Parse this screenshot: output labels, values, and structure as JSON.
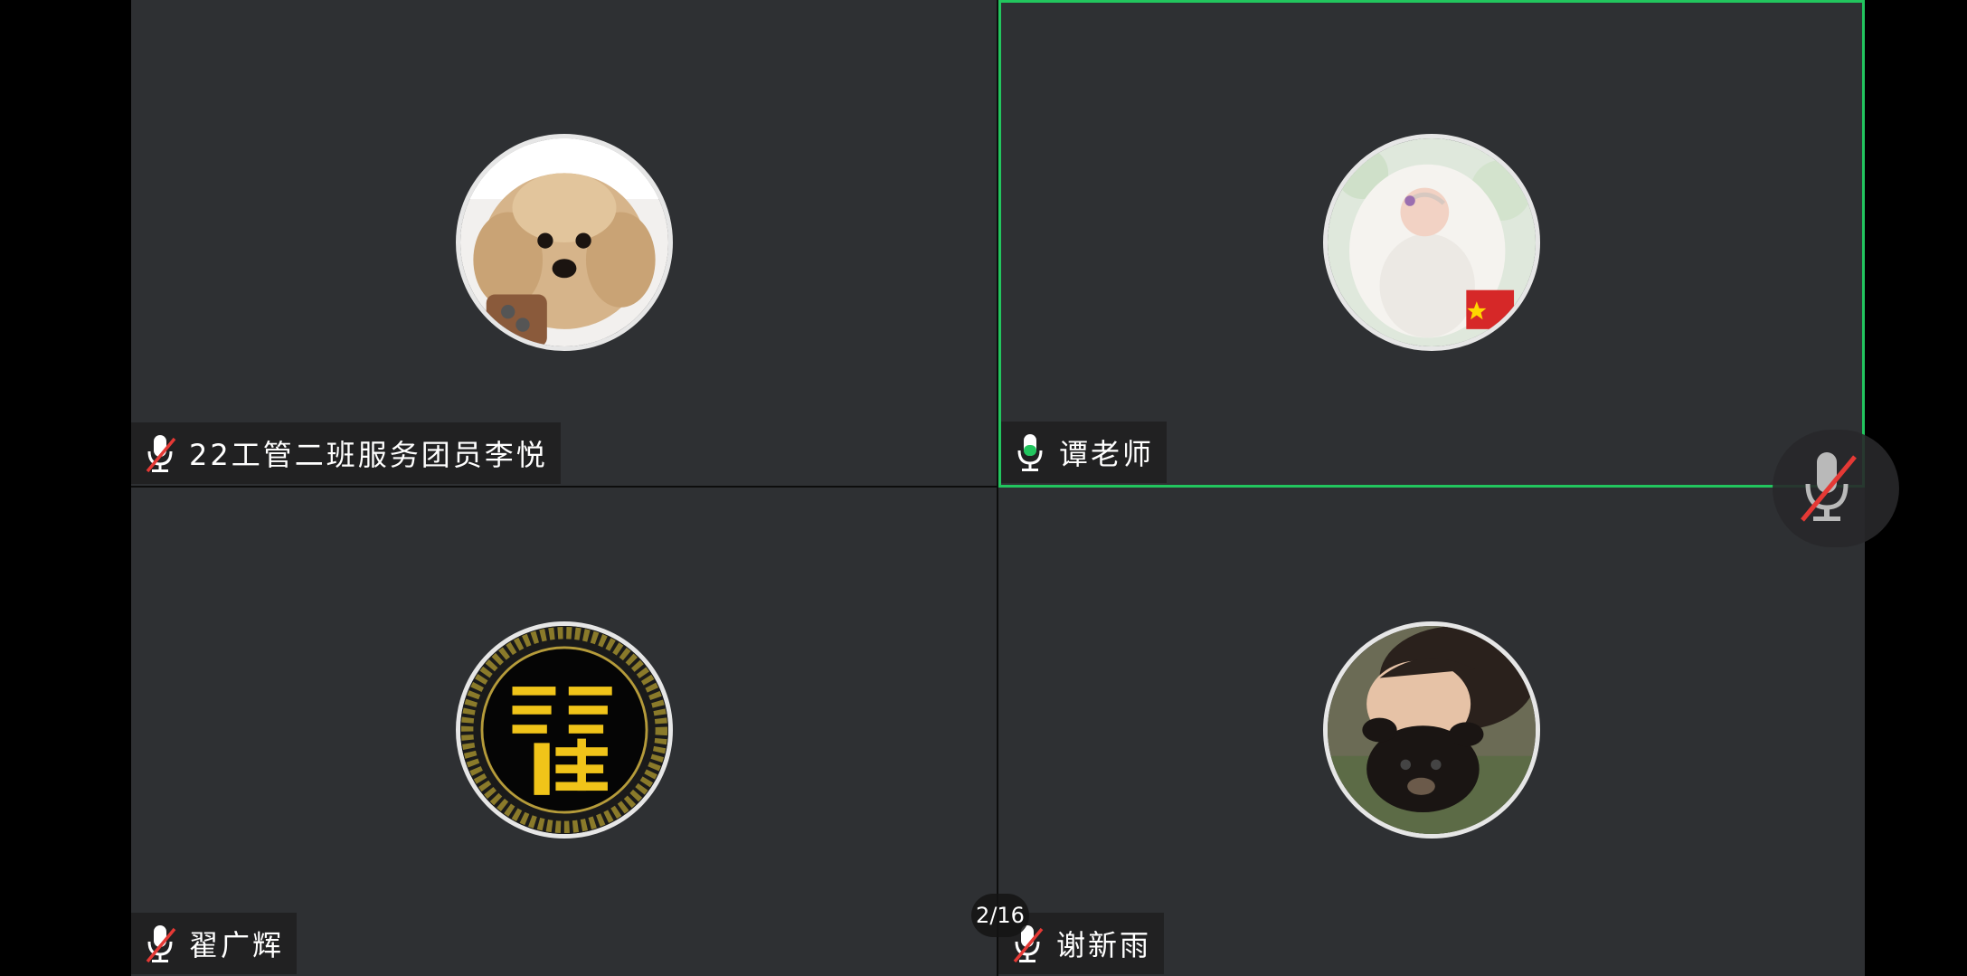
{
  "participants": [
    {
      "name": "22工管二班服务团员李悦",
      "mic": "muted",
      "avatar": "poodle-dog-avatar"
    },
    {
      "name": "谭老师",
      "mic": "active",
      "avatar": "baby-avatar",
      "speaking": true
    },
    {
      "name": "翟广辉",
      "mic": "muted",
      "avatar": "zhai-calligraphy-avatar"
    },
    {
      "name": "谢新雨",
      "mic": "muted",
      "avatar": "person-with-puppy-avatar"
    }
  ],
  "page_indicator": "2/16",
  "colors": {
    "tile_bg": "#2e3033",
    "active_border": "#22c55e",
    "muted_slash": "#e53935",
    "mic_active": "#22c55e"
  },
  "icons": {
    "mic_muted": "mic-muted-icon",
    "mic_active": "mic-active-icon",
    "floating_mic": "floating-mic-muted-icon"
  }
}
